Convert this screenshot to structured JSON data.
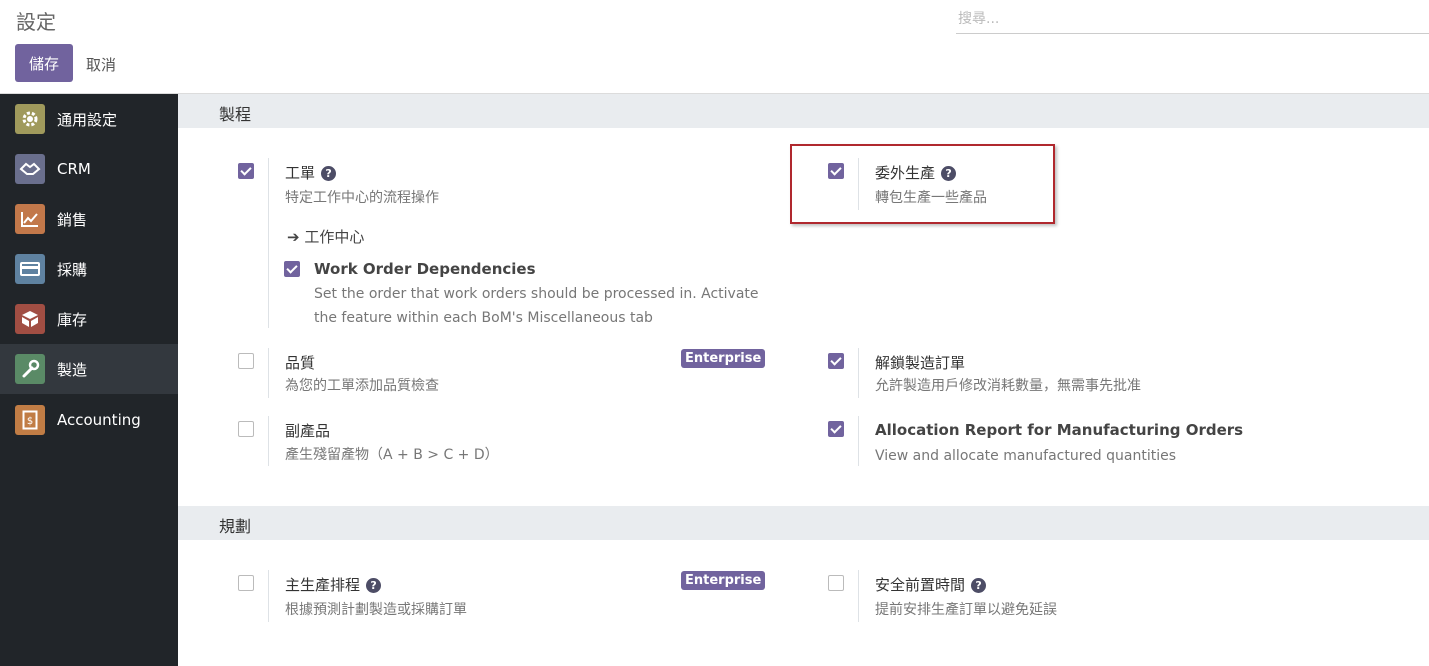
{
  "header": {
    "title": "設定",
    "search_placeholder": "搜尋...",
    "save_label": "儲存",
    "cancel_label": "取消"
  },
  "sidebar": {
    "items": [
      {
        "label": "通用設定",
        "icon": "gear-icon",
        "color": "#a09a5c"
      },
      {
        "label": "CRM",
        "icon": "handshake-icon",
        "color": "#6a6f8d"
      },
      {
        "label": "銷售",
        "icon": "chart-icon",
        "color": "#c2784a"
      },
      {
        "label": "採購",
        "icon": "card-icon",
        "color": "#5f82a0"
      },
      {
        "label": "庫存",
        "icon": "box-icon",
        "color": "#a14e43"
      },
      {
        "label": "製造",
        "icon": "wrench-icon",
        "color": "#5a8a66"
      },
      {
        "label": "Accounting",
        "icon": "invoice-icon",
        "color": "#c17d45"
      }
    ]
  },
  "sections": {
    "manufacturing": {
      "title": "製程"
    },
    "planning": {
      "title": "規劃"
    }
  },
  "options": {
    "workorders": {
      "title": "工單",
      "desc": "特定工作中心的流程操作",
      "link": "工作中心",
      "checked": true
    },
    "dependencies": {
      "title": "Work Order Dependencies",
      "desc1": "Set the order that work orders should be processed in. Activate",
      "desc2": "the feature within each BoM's Miscellaneous tab",
      "checked": true
    },
    "subcontracting": {
      "title": "委外生產",
      "desc": "轉包生產一些產品",
      "checked": true
    },
    "quality": {
      "title": "品質",
      "desc": "為您的工單添加品質檢查",
      "badge": "Enterprise",
      "checked": false
    },
    "unlock": {
      "title": "解鎖製造訂單",
      "desc": "允許製造用戶修改消耗數量，無需事先批准",
      "checked": true
    },
    "byproducts": {
      "title": "副產品",
      "desc": "產生殘留產物（A + B > C + D）",
      "checked": false
    },
    "allocation": {
      "title": "Allocation Report for Manufacturing Orders",
      "desc": "View and allocate manufactured quantities",
      "checked": true
    },
    "mps": {
      "title": "主生產排程",
      "desc": "根據預測計劃製造或採購訂單",
      "badge": "Enterprise",
      "checked": false
    },
    "lead_time": {
      "title": "安全前置時間",
      "desc": "提前安排生產訂單以避免延誤",
      "checked": false
    }
  }
}
